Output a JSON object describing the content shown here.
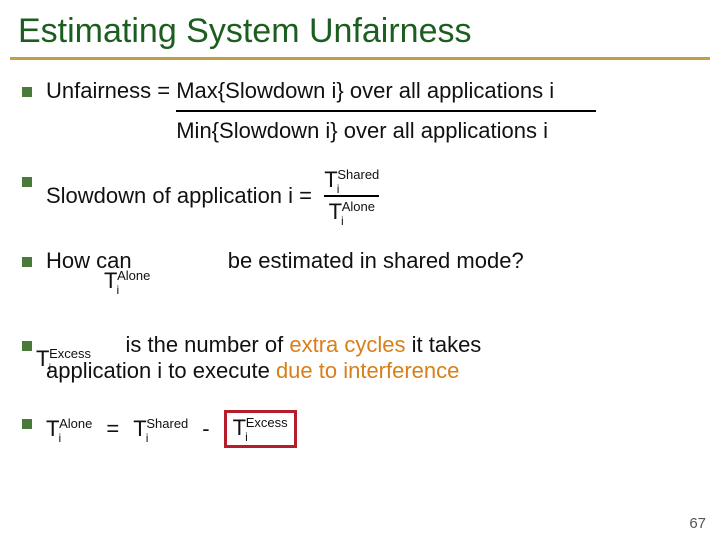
{
  "title": "Estimating System Unfairness",
  "bullet1": {
    "lead": "Unfairness = ",
    "numerator": "Max{Slowdown i} over all applications i",
    "denominator": "Min{Slowdown i} over all applications i"
  },
  "bullet2": {
    "lead": "Slowdown of application i =  ",
    "t_num_base": "T",
    "t_num_sub": "i",
    "t_num_sup": "Shared",
    "t_den_base": "T",
    "t_den_sub": "i",
    "t_den_sup": "Alone"
  },
  "bullet3": {
    "q1": "How can ",
    "q2": " be estimated in shared mode?",
    "ta_base": "T",
    "ta_sub": "i",
    "ta_sup": "Alone"
  },
  "bullet4": {
    "pre_gap": "             ",
    "line1_a": "is the number of ",
    "line1_orange": "extra cycles",
    "line1_b": " it takes",
    "tex_base": "T",
    "tex_sub": "i",
    "tex_sup": "Excess",
    "line2_a": "application i to execute ",
    "line2_orange": "due to interference"
  },
  "bullet5": {
    "eq_sign": "=",
    "minus": "-",
    "t1_base": "T",
    "t1_sub": "i",
    "t1_sup": "Alone",
    "t2_base": "T",
    "t2_sub": "i",
    "t2_sup": "Shared",
    "t3_base": "T",
    "t3_sub": "i",
    "t3_sup": "Excess"
  },
  "pagenum": "67"
}
